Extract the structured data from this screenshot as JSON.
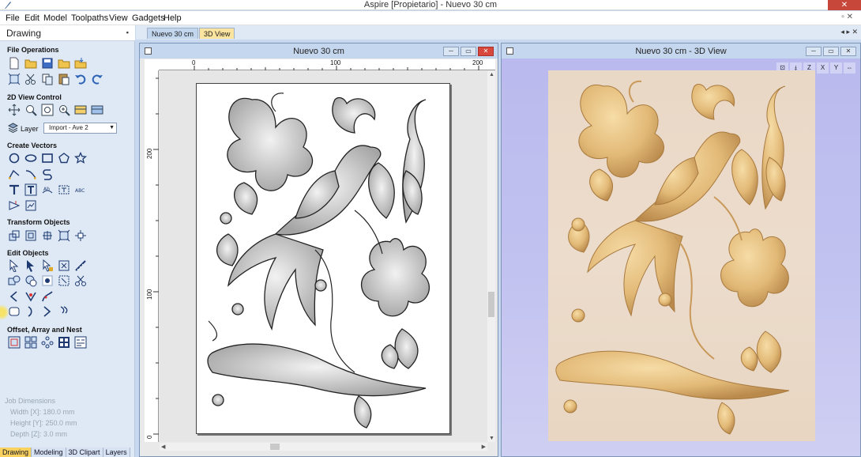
{
  "window": {
    "title": "Aspire [Propietario] - Nuevo 30 cm",
    "close_label": "✕"
  },
  "menu": [
    "File",
    "Edit",
    "Model",
    "Toolpaths",
    "View",
    "Gadgets",
    "Help"
  ],
  "left_panel": {
    "title": "Drawing",
    "pin": "▪",
    "sections": {
      "file_operations": "File Operations",
      "view_control": "2D View Control",
      "create_vectors": "Create Vectors",
      "transform_objects": "Transform Objects",
      "edit_objects": "Edit Objects",
      "offset_array": "Offset, Array and Nest"
    },
    "layer": {
      "label": "Layer",
      "value": "Import - Ave 2"
    },
    "job_dimensions": {
      "title": "Job Dimensions",
      "width": "Width  [X]: 180.0 mm",
      "height": "Height [Y]: 250.0 mm",
      "depth": "Depth  [Z]: 3.0 mm"
    },
    "bottom_tabs": [
      "Drawing",
      "Modeling",
      "3D Clipart",
      "Layers"
    ],
    "active_tab": "Drawing"
  },
  "document_tabs": [
    "Nuevo 30 cm",
    "3D View"
  ],
  "doc_nav": "◂ ▸ ✕",
  "view2d": {
    "title": "Nuevo 30 cm",
    "ruler_h": [
      "0",
      "100",
      "200"
    ],
    "ruler_v": [
      "200",
      "100",
      "0"
    ]
  },
  "view3d": {
    "title": "Nuevo 30 cm - 3D View",
    "toolbar": [
      "⊡",
      "⤈",
      "Z",
      "X",
      "Y",
      "⇔"
    ]
  },
  "colors": {
    "panel_bg": "#dfe9f6",
    "tab_active": "#f8d15e",
    "bg_3d": "#c2c2f0",
    "wood": "#e2b977",
    "close_red": "#c7473a"
  }
}
